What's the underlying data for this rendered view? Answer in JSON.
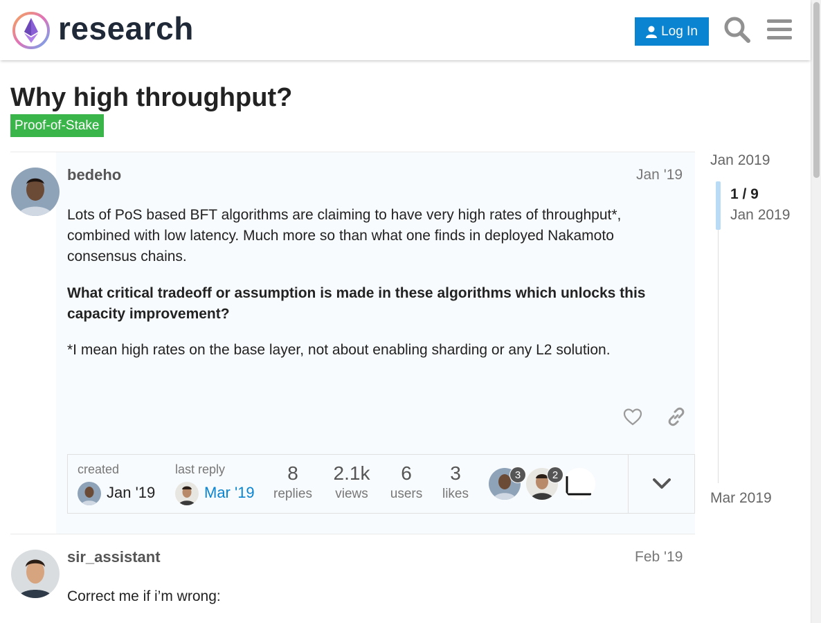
{
  "header": {
    "site_name": "research",
    "login_label": "Log In"
  },
  "topic": {
    "title": "Why high throughput?",
    "category": "Proof-of-Stake",
    "category_color": "#3ab54a"
  },
  "posts": [
    {
      "username": "bedeho",
      "date": "Jan '19",
      "paragraphs": [
        "Lots of PoS based BFT algorithms are claiming to have very high rates of throughput*, combined with low latency. Much more so than what one finds in deployed Nakamoto consensus chains.",
        "What critical tradeoff or assumption is made in these algorithms which unlocks this capacity improvement?",
        "*I mean high rates on the base layer, not about enabling sharding or any L2 solution."
      ]
    },
    {
      "username": "sir_assistant",
      "date": "Feb '19",
      "paragraphs": [
        "Correct me if i’m wrong:"
      ]
    }
  ],
  "topic_map": {
    "created_label": "created",
    "created_date": "Jan '19",
    "last_reply_label": "last reply",
    "last_reply_date": "Mar '19",
    "stats": [
      {
        "value": "8",
        "label": "replies"
      },
      {
        "value": "2.1k",
        "label": "views"
      },
      {
        "value": "6",
        "label": "users"
      },
      {
        "value": "3",
        "label": "likes"
      }
    ],
    "participants": [
      {
        "count": "3"
      },
      {
        "count": "2"
      },
      {
        "count": ""
      }
    ]
  },
  "timeline": {
    "start_date": "Jan 2019",
    "position": "1 / 9",
    "position_date": "Jan 2019",
    "end_date": "Mar 2019"
  },
  "colors": {
    "accent": "#0a84d0",
    "link": "#0a84d0"
  }
}
